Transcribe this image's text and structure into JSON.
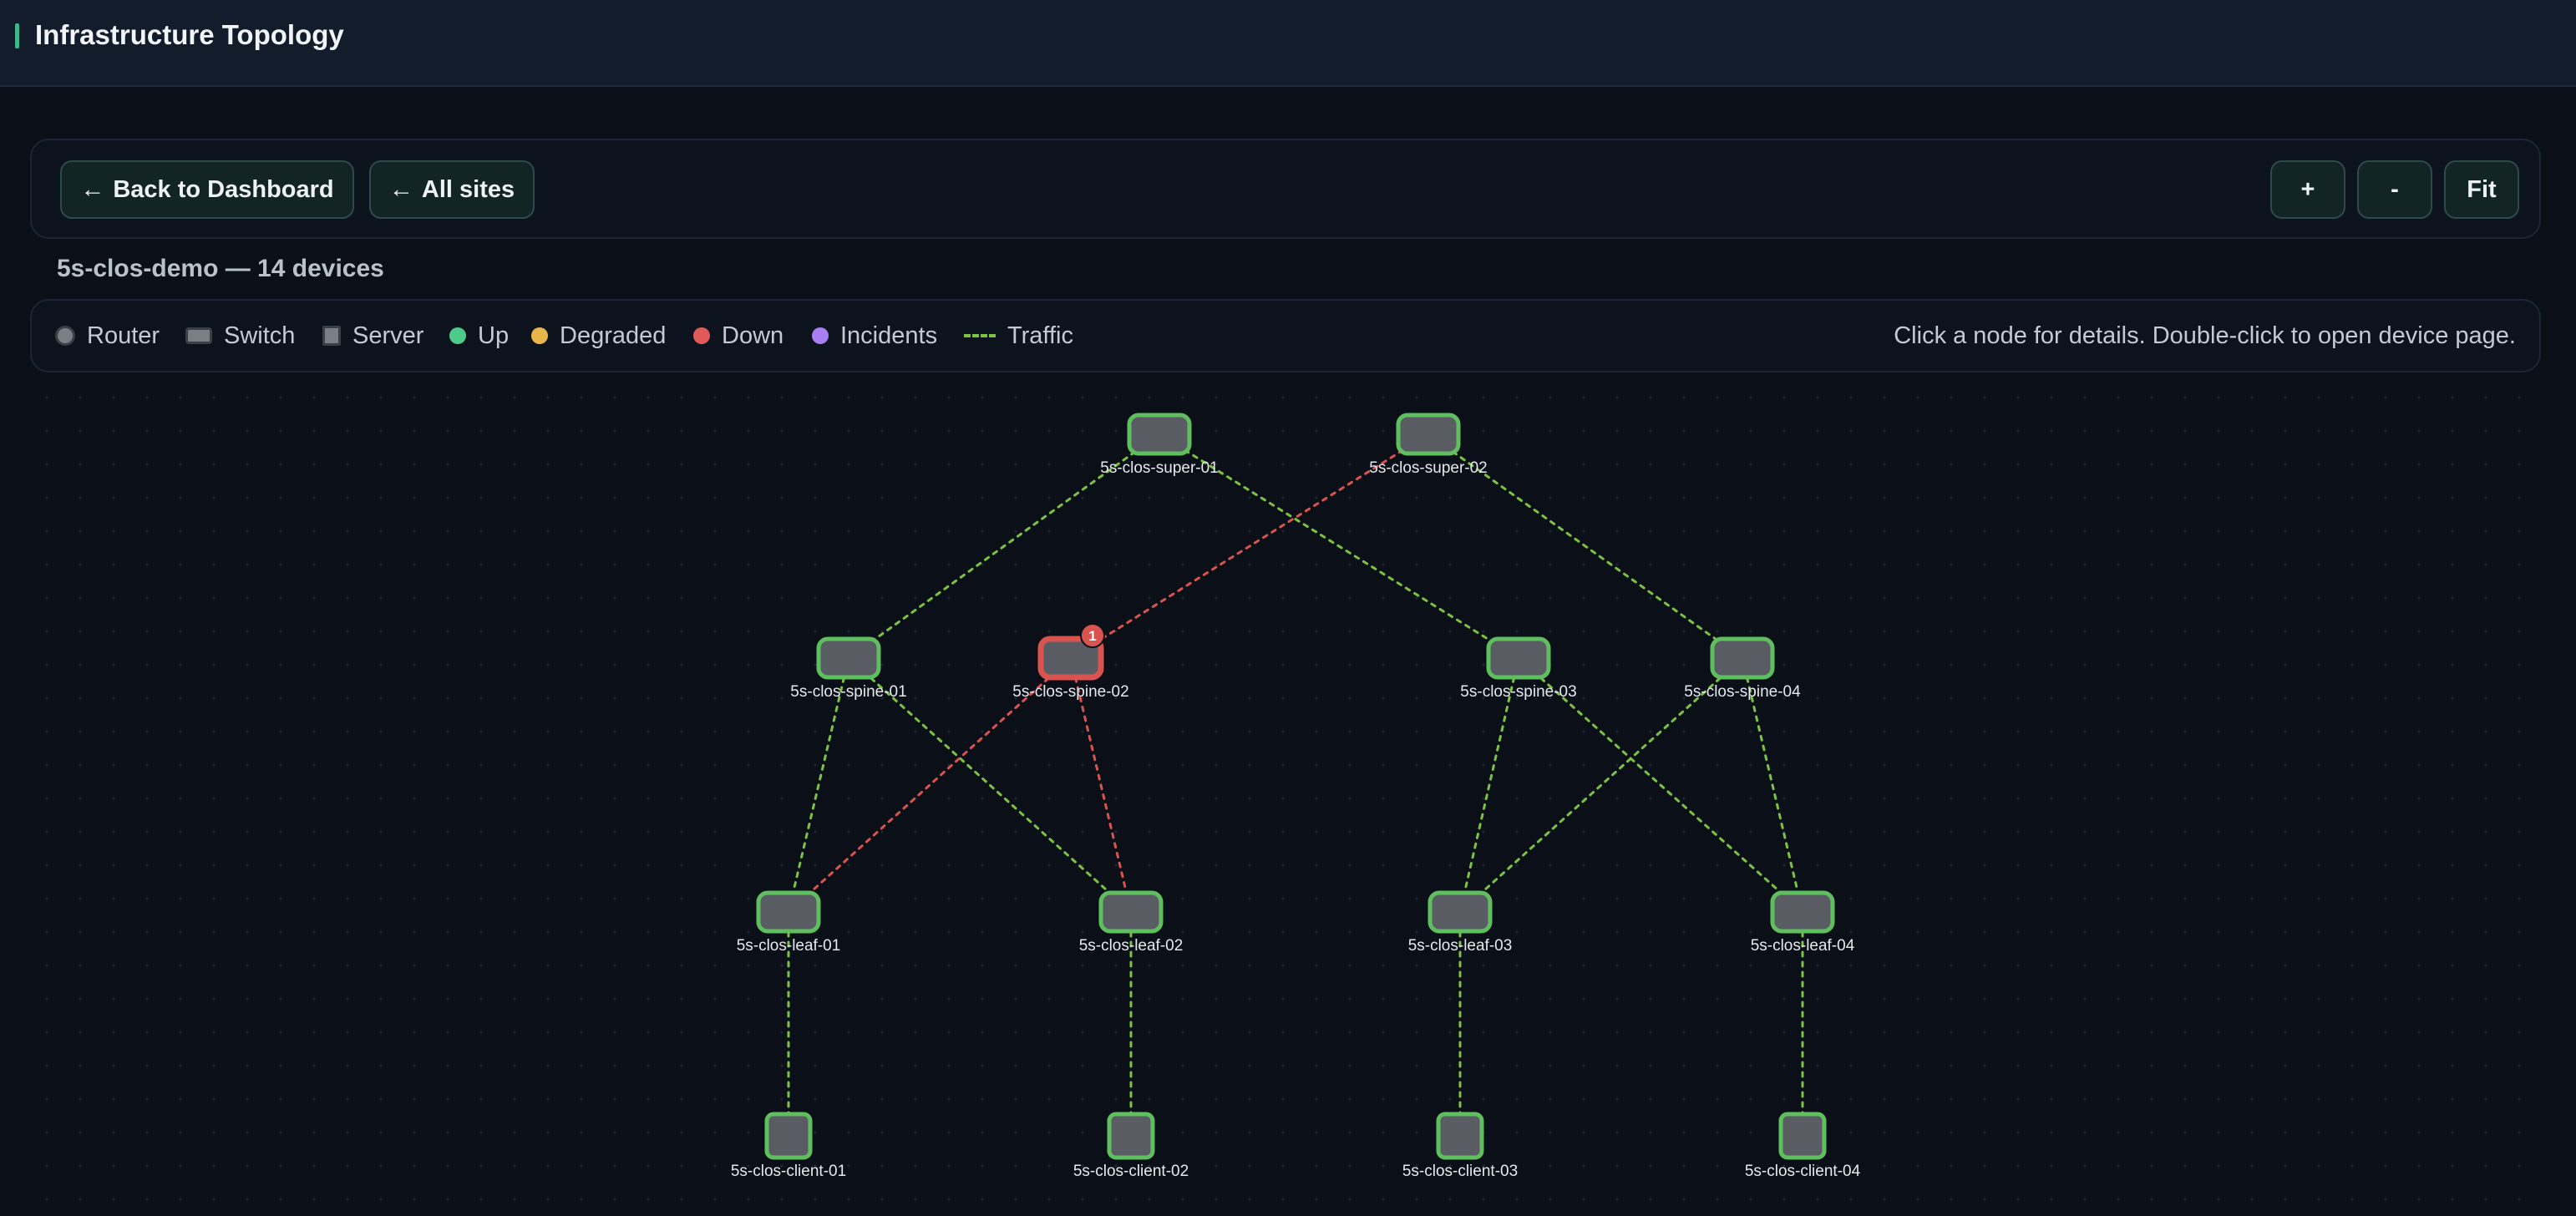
{
  "header": {
    "title": "Infrastructure Topology"
  },
  "toolbar": {
    "back_label": "Back to Dashboard",
    "all_sites_label": "All sites",
    "back_icon": "arrow-left-icon",
    "zoom_in_label": "+",
    "zoom_out_label": "-",
    "fit_label": "Fit"
  },
  "site": {
    "heading": "5s-clos-demo — 14 devices"
  },
  "legend": {
    "items": [
      {
        "label": "Router",
        "icon": "router-icon"
      },
      {
        "label": "Switch",
        "icon": "switch-icon"
      },
      {
        "label": "Server",
        "icon": "server-icon"
      },
      {
        "label": "Up",
        "color": "#4ecb8a"
      },
      {
        "label": "Degraded",
        "color": "#e8b54a"
      },
      {
        "label": "Down",
        "color": "#e05a5a"
      },
      {
        "label": "Incidents",
        "color": "#a87ef0"
      },
      {
        "label": "Traffic",
        "color": "#7cc243"
      }
    ],
    "hint": "Click a node for details. Double-click to open device page."
  },
  "colors": {
    "up": "#5fbf5f",
    "down": "#d9534f",
    "link_up": "#7cc243",
    "link_down": "#d9534f",
    "node_fill": "#595d63"
  },
  "topology": {
    "nodes": [
      {
        "id": "5s-clos-super-01",
        "label": "5s-clos-super-01",
        "kind": "switch",
        "status": "up"
      },
      {
        "id": "5s-clos-super-02",
        "label": "5s-clos-super-02",
        "kind": "switch",
        "status": "up"
      },
      {
        "id": "5s-clos-spine-01",
        "label": "5s-clos-spine-01",
        "kind": "switch",
        "status": "up"
      },
      {
        "id": "5s-clos-spine-02",
        "label": "5s-clos-spine-02",
        "kind": "switch",
        "status": "down",
        "incidents": "1"
      },
      {
        "id": "5s-clos-spine-03",
        "label": "5s-clos-spine-03",
        "kind": "switch",
        "status": "up"
      },
      {
        "id": "5s-clos-spine-04",
        "label": "5s-clos-spine-04",
        "kind": "switch",
        "status": "up"
      },
      {
        "id": "5s-clos-leaf-01",
        "label": "5s-clos-leaf-01",
        "kind": "switch",
        "status": "up"
      },
      {
        "id": "5s-clos-leaf-02",
        "label": "5s-clos-leaf-02",
        "kind": "switch",
        "status": "up"
      },
      {
        "id": "5s-clos-leaf-03",
        "label": "5s-clos-leaf-03",
        "kind": "switch",
        "status": "up"
      },
      {
        "id": "5s-clos-leaf-04",
        "label": "5s-clos-leaf-04",
        "kind": "switch",
        "status": "up"
      },
      {
        "id": "5s-clos-client-01",
        "label": "5s-clos-client-01",
        "kind": "server",
        "status": "up"
      },
      {
        "id": "5s-clos-client-02",
        "label": "5s-clos-client-02",
        "kind": "server",
        "status": "up"
      },
      {
        "id": "5s-clos-client-03",
        "label": "5s-clos-client-03",
        "kind": "server",
        "status": "up"
      },
      {
        "id": "5s-clos-client-04",
        "label": "5s-clos-client-04",
        "kind": "server",
        "status": "up"
      }
    ],
    "links": [
      {
        "from": "5s-clos-super-01",
        "to": "5s-clos-spine-01",
        "status": "up"
      },
      {
        "from": "5s-clos-super-01",
        "to": "5s-clos-spine-03",
        "status": "up"
      },
      {
        "from": "5s-clos-super-02",
        "to": "5s-clos-spine-02",
        "status": "down"
      },
      {
        "from": "5s-clos-super-02",
        "to": "5s-clos-spine-04",
        "status": "up"
      },
      {
        "from": "5s-clos-spine-01",
        "to": "5s-clos-leaf-01",
        "status": "up"
      },
      {
        "from": "5s-clos-spine-01",
        "to": "5s-clos-leaf-02",
        "status": "up"
      },
      {
        "from": "5s-clos-spine-02",
        "to": "5s-clos-leaf-01",
        "status": "down"
      },
      {
        "from": "5s-clos-spine-02",
        "to": "5s-clos-leaf-02",
        "status": "down"
      },
      {
        "from": "5s-clos-spine-03",
        "to": "5s-clos-leaf-03",
        "status": "up"
      },
      {
        "from": "5s-clos-spine-03",
        "to": "5s-clos-leaf-04",
        "status": "up"
      },
      {
        "from": "5s-clos-spine-04",
        "to": "5s-clos-leaf-03",
        "status": "up"
      },
      {
        "from": "5s-clos-spine-04",
        "to": "5s-clos-leaf-04",
        "status": "up"
      },
      {
        "from": "5s-clos-leaf-01",
        "to": "5s-clos-client-01",
        "status": "up"
      },
      {
        "from": "5s-clos-leaf-02",
        "to": "5s-clos-client-02",
        "status": "up"
      },
      {
        "from": "5s-clos-leaf-03",
        "to": "5s-clos-client-03",
        "status": "up"
      },
      {
        "from": "5s-clos-leaf-04",
        "to": "5s-clos-client-04",
        "status": "up"
      }
    ]
  }
}
